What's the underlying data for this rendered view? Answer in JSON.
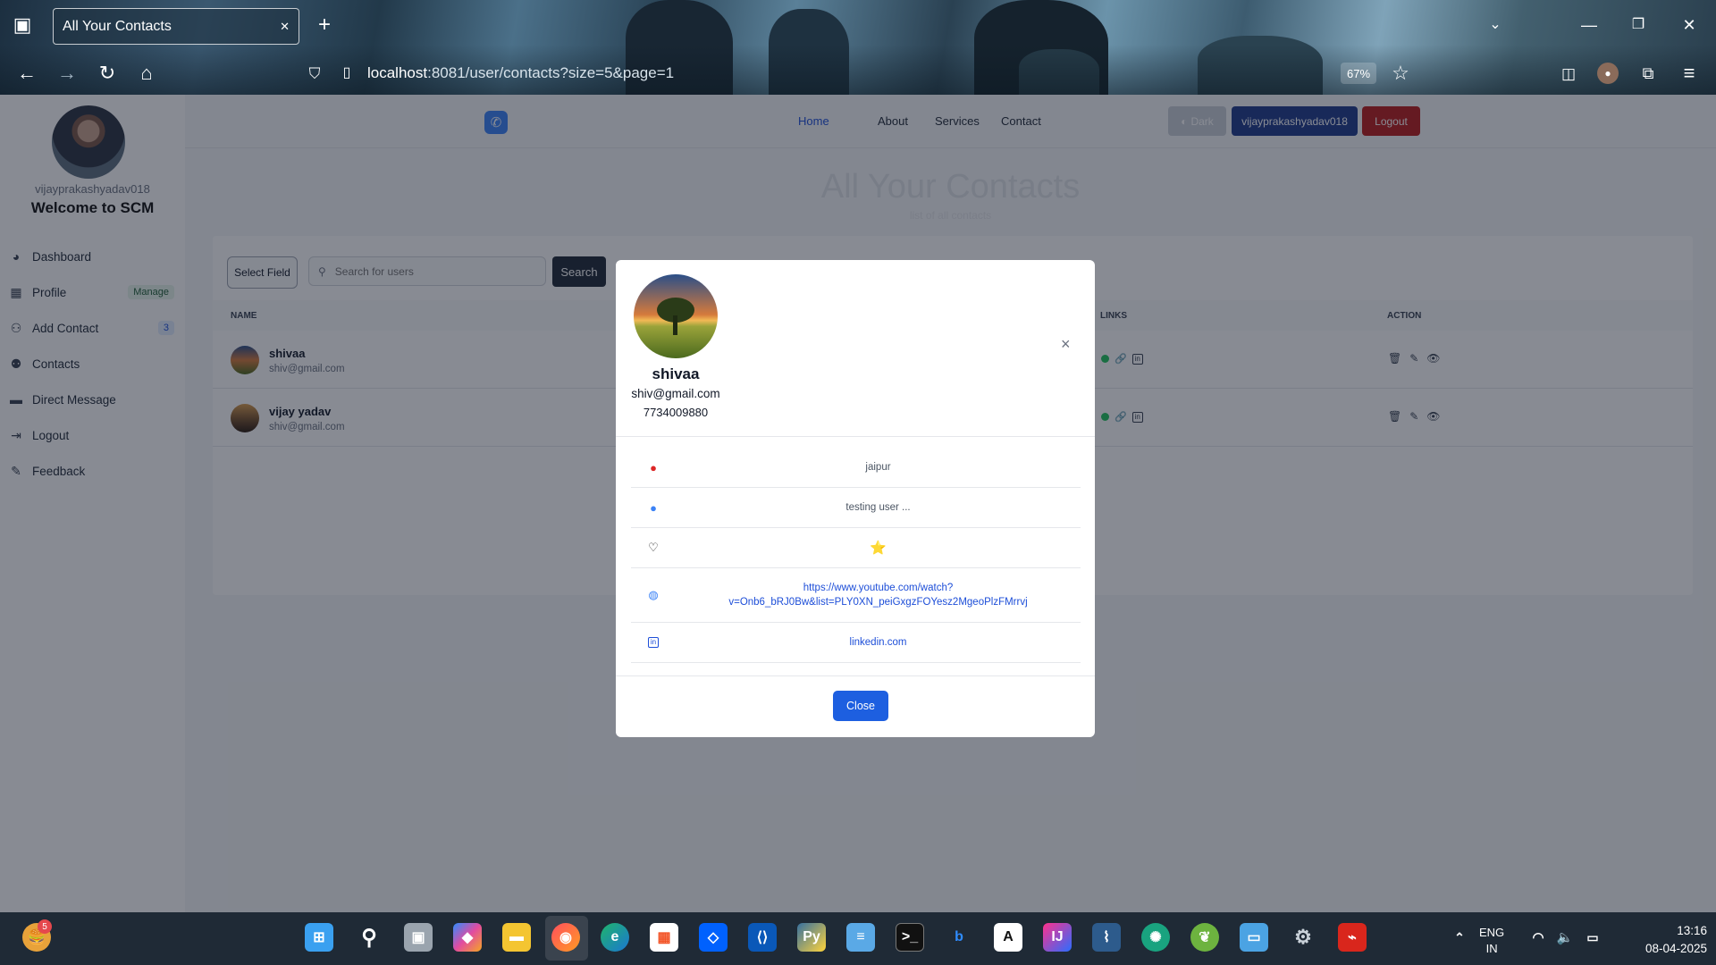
{
  "browser": {
    "tab_title": "All Your Contacts",
    "tab_close": "✕",
    "new_tab": "+",
    "url_host": "localhost",
    "url_rest": ":8081/user/contacts?size=5&page=1",
    "zoom": "67%"
  },
  "sidebar": {
    "username": "vijayprakashyadav018",
    "welcome": "Welcome to SCM",
    "items": [
      {
        "label": "Dashboard",
        "icon": "dashboard-icon"
      },
      {
        "label": "Profile",
        "icon": "grid-icon",
        "badge": "Manage"
      },
      {
        "label": "Add Contact",
        "icon": "add-user-icon",
        "badge": "3"
      },
      {
        "label": "Contacts",
        "icon": "users-icon"
      },
      {
        "label": "Direct Message",
        "icon": "briefcase-icon"
      },
      {
        "label": "Logout",
        "icon": "logout-icon"
      },
      {
        "label": "Feedback",
        "icon": "feedback-icon"
      }
    ]
  },
  "topnav": {
    "links": [
      "Home",
      "About",
      "Services",
      "Contact"
    ],
    "dark_label": "Dark",
    "user_label": "vijayprakashyadav018",
    "logout_label": "Logout"
  },
  "page": {
    "title": "All Your Contacts",
    "subtitle": "list of all contacts"
  },
  "contacts": {
    "select_field": "Select Field",
    "search_placeholder": "Search for users",
    "search_button": "Search",
    "headers": {
      "name": "NAME",
      "links": "LINKS",
      "action": "ACTION"
    },
    "rows": [
      {
        "name": "shivaa",
        "email": "shiv@gmail.com"
      },
      {
        "name": "vijay yadav",
        "email": "shiv@gmail.com"
      }
    ]
  },
  "modal": {
    "name": "shivaa",
    "email": "shiv@gmail.com",
    "phone": "7734009880",
    "close_x": "×",
    "address": "jaipur",
    "description": "testing user ...",
    "favorite": "⭐",
    "website_line1": "https://www.youtube.com/watch?",
    "website_line2": "v=Onb6_bRJ0Bw&list=PLY0XN_peiGxgzFOYesz2MgeoPlzFMrrvj",
    "linkedin": "linkedin.com",
    "close_button": "Close"
  },
  "taskbar": {
    "notification_count": "5",
    "lang_line1": "ENG",
    "lang_line2": "IN",
    "time": "13:16",
    "date": "08-04-2025"
  },
  "colors": {
    "primary": "#1d5fe0",
    "user_button": "#1e3a8a",
    "logout_button": "#b91c1c",
    "online_dot": "#22c55e"
  }
}
